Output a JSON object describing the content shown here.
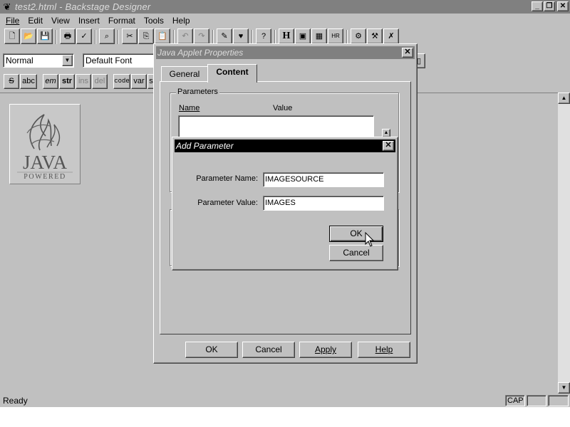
{
  "window": {
    "title": "test2.html - Backstage Designer",
    "app_icon": "backstage-app-icon"
  },
  "menu": [
    "File",
    "Edit",
    "View",
    "Insert",
    "Format",
    "Tools",
    "Help"
  ],
  "toolbar1": {
    "heading_button": "H"
  },
  "format_bar": {
    "style_value": "Normal",
    "font_value": "Default Font"
  },
  "text_format_buttons": [
    "S",
    "abc",
    "em",
    "str",
    "ins",
    "del",
    "code",
    "var",
    "s"
  ],
  "java_logo": {
    "word": "JAVA",
    "tagline": "POWERED"
  },
  "status": {
    "text": "Ready",
    "cap": "CAP"
  },
  "properties_dialog": {
    "title": "Java Applet Properties",
    "tabs": [
      {
        "label": "General",
        "active": false
      },
      {
        "label": "Content",
        "active": true
      }
    ],
    "parameters_group": "Parameters",
    "columns": [
      "Name",
      "Value"
    ],
    "buttons": {
      "ok": "OK",
      "cancel": "Cancel",
      "apply": "Apply",
      "help": "Help"
    }
  },
  "add_parameter_dialog": {
    "title": "Add Parameter",
    "name_label": "Parameter Name:",
    "value_label": "Parameter Value:",
    "name_value": "IMAGESOURCE",
    "value_value": "IMAGES",
    "ok": "OK",
    "cancel": "Cancel"
  },
  "colors": {
    "face": "#c0c0c0",
    "inactive_title": "#808080",
    "active_title": "#000000"
  }
}
